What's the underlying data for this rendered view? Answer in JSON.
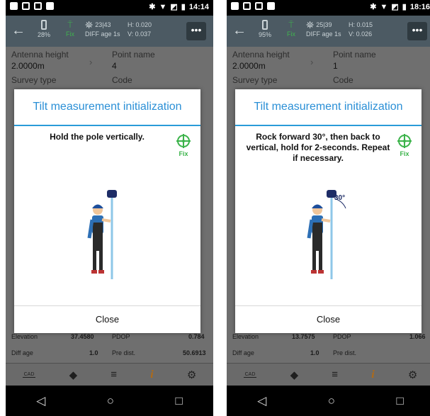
{
  "screens": [
    {
      "status": {
        "time": "14:14"
      },
      "toolbar": {
        "battery": "28%",
        "solution": "Fix",
        "sats": "23|43",
        "diff_age": "DIFF age 1s",
        "h": "H: 0.020",
        "v": "V: 0.037"
      },
      "fields": {
        "antenna_height_label": "Antenna height",
        "antenna_height_value": "2.0000m",
        "point_name_label": "Point name",
        "point_name_value": "4",
        "survey_type_label": "Survey type",
        "code_label": "Code"
      },
      "bottom_info": {
        "elevation_label": "Elevation",
        "elevation_value": "37.4580",
        "pdop_label": "PDOP",
        "pdop_value": "0.784",
        "diff_age_label": "Diff age",
        "diff_age_value": "1.0",
        "pre_dist_label": "Pre dist.",
        "pre_dist_value": "50.6913"
      },
      "dialog": {
        "title": "Tilt measurement initialization",
        "message": "Hold the pole vertically.",
        "fix_label": "Fix",
        "close_label": "Close"
      }
    },
    {
      "status": {
        "time": "18:16"
      },
      "toolbar": {
        "battery": "95%",
        "solution": "Fix",
        "sats": "25|39",
        "diff_age": "DIFF age 1s",
        "h": "H: 0.015",
        "v": "V: 0.026"
      },
      "fields": {
        "antenna_height_label": "Antenna height",
        "antenna_height_value": "2.0000m",
        "point_name_label": "Point name",
        "point_name_value": "1",
        "survey_type_label": "Survey type",
        "code_label": "Code"
      },
      "bottom_info": {
        "elevation_label": "Elevation",
        "elevation_value": "13.7575",
        "pdop_label": "PDOP",
        "pdop_value": "1.066",
        "diff_age_label": "Diff age",
        "diff_age_value": "1.0",
        "pre_dist_label": "Pre dist.",
        "pre_dist_value": ""
      },
      "dialog": {
        "title": "Tilt measurement initialization",
        "message": "Rock forward 30°, then back to vertical, hold for 2-seconds. Repeat if necessary.",
        "fix_label": "Fix",
        "close_label": "Close",
        "angle_label": "30°"
      }
    }
  ],
  "nav": {
    "cad_label": "CAD",
    "info_label": "i"
  },
  "colors": {
    "accent": "#2a8fd6",
    "fix_green": "#3bb34a",
    "toolbar": "#4c5a63"
  }
}
